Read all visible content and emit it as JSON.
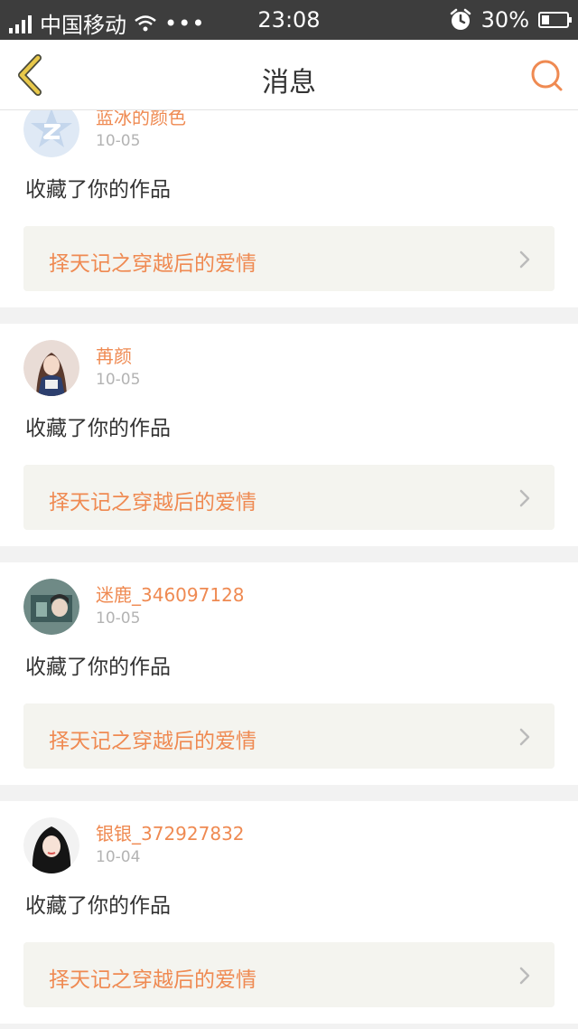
{
  "status_bar": {
    "carrier": "中国移动",
    "more": "•••",
    "time": "23:08",
    "battery_percent": "30%",
    "battery_level": 0.3,
    "icons": [
      "signal-icon",
      "wifi-icon",
      "alarm-icon",
      "battery-icon"
    ]
  },
  "nav": {
    "title": "消息",
    "back_icon": "chevron-left-icon",
    "search_icon": "search-icon"
  },
  "colors": {
    "accent": "#ef8a52",
    "back_arrow": "#e8c84a",
    "status_bar": "#3d3d3d",
    "work_bg": "#f4f4ef"
  },
  "messages": [
    {
      "username": "蓝冰的颜色",
      "date": "10-05",
      "action": "收藏了你的作品",
      "work_title": "择天记之穿越后的爱情",
      "avatar": "qq-default-avatar-icon"
    },
    {
      "username": "苒颜",
      "date": "10-05",
      "action": "收藏了你的作品",
      "work_title": "择天记之穿越后的爱情",
      "avatar": "user-photo-avatar"
    },
    {
      "username": "迷鹿_346097128",
      "date": "10-05",
      "action": "收藏了你的作品",
      "work_title": "择天记之穿越后的爱情",
      "avatar": "user-photo-avatar"
    },
    {
      "username": "银银_372927832",
      "date": "10-04",
      "action": "收藏了你的作品",
      "work_title": "择天记之穿越后的爱情",
      "avatar": "user-photo-avatar"
    }
  ]
}
